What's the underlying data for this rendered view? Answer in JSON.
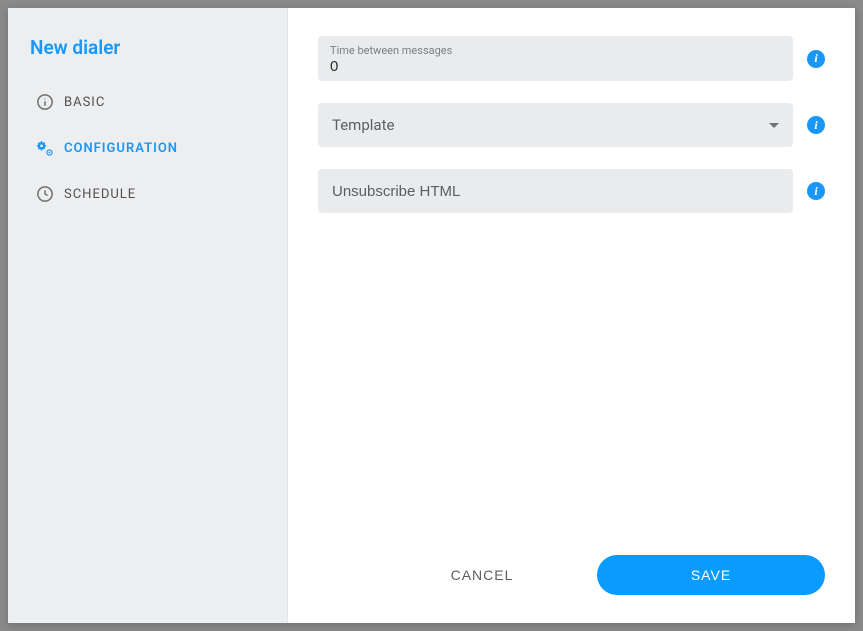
{
  "sidebar": {
    "title": "New dialer",
    "items": [
      {
        "label": "BASIC"
      },
      {
        "label": "CONFIGURATION"
      },
      {
        "label": "SCHEDULE"
      }
    ]
  },
  "fields": {
    "time_between": {
      "label": "Time between messages",
      "value": "0"
    },
    "template": {
      "placeholder": "Template"
    },
    "unsubscribe": {
      "placeholder": "Unsubscribe HTML"
    }
  },
  "footer": {
    "cancel": "CANCEL",
    "save": "SAVE"
  },
  "info_glyph": "i"
}
